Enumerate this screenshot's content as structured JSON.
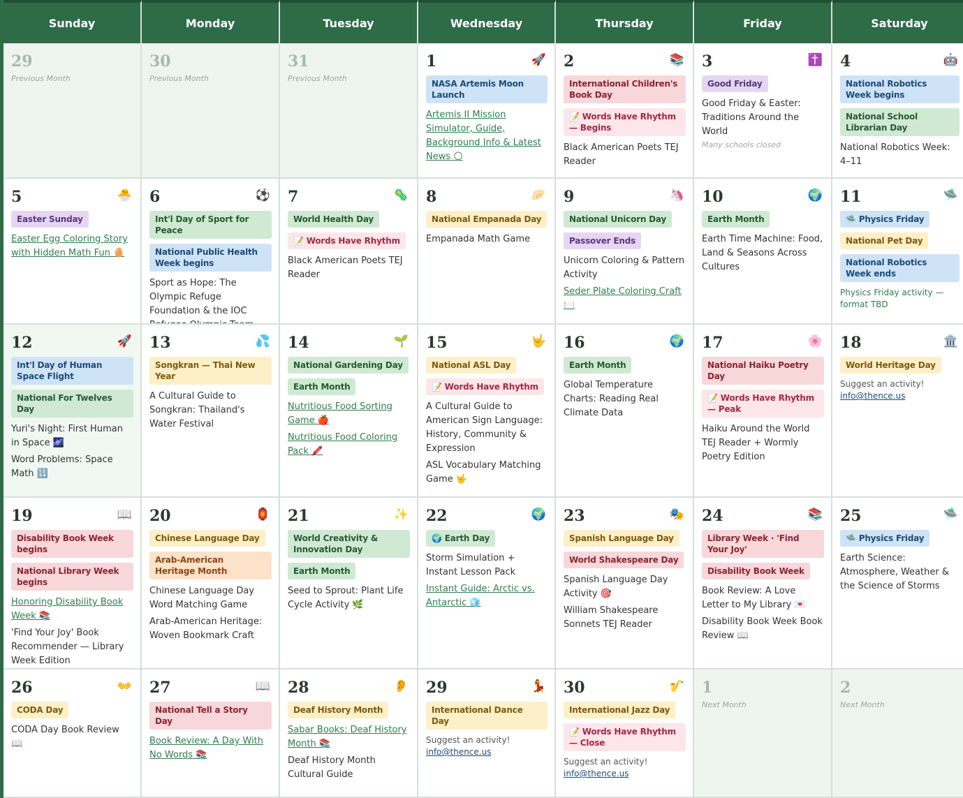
{
  "headers": [
    "Sunday",
    "Monday",
    "Tuesday",
    "Wednesday",
    "Thursday",
    "Friday",
    "Saturday"
  ],
  "prev_label": "Previous Month",
  "next_label": "Next Month",
  "suggest": "Suggest an activity!",
  "email": "info@thence.us",
  "days": {
    "d29p": "29",
    "d30p": "30",
    "d31p": "31",
    "d1": "1",
    "d2": "2",
    "d3": "3",
    "d4": "4",
    "d5": "5",
    "d6": "6",
    "d7": "7",
    "d8": "8",
    "d9": "9",
    "d10": "10",
    "d11": "11",
    "d12": "12",
    "d13": "13",
    "d14": "14",
    "d15": "15",
    "d16": "16",
    "d17": "17",
    "d18": "18",
    "d19": "19",
    "d20": "20",
    "d21": "21",
    "d22": "22",
    "d23": "23",
    "d24": "24",
    "d25": "25",
    "d26": "26",
    "d27": "27",
    "d28": "28",
    "d29": "29",
    "d30": "30",
    "n1": "1",
    "n2": "2"
  },
  "icons": {
    "d1": "🚀",
    "d2": "📚",
    "d3": "✝️",
    "d4": "🤖",
    "d5": "🐣",
    "d6": "⚽",
    "d7": "🦠",
    "d8": "🥟",
    "d9": "🦄",
    "d10": "🌍",
    "d11": "🛸",
    "d12": "🚀",
    "d13": "💦",
    "d14": "🌱",
    "d15": "🤟",
    "d16": "🌍",
    "d17": "🌸",
    "d18": "🏛️",
    "d19": "📖",
    "d20": "🏮",
    "d21": "✨",
    "d22": "🌍",
    "d23": "🎭",
    "d24": "📚",
    "d25": "🛸",
    "d26": "👐",
    "d27": "📖",
    "d28": "👂",
    "d29": "💃",
    "d30": "🎷"
  },
  "events": {
    "d1": {
      "tag1": "NASA Artemis Moon Launch",
      "link1": "Artemis II Mission Simulator, Guide, Background Info & Latest News 🌕"
    },
    "d2": {
      "tag1": "International Children's Book Day",
      "tag2": "📝 Words Have Rhythm — Begins",
      "txt1": "Black American Poets TEJ Reader"
    },
    "d3": {
      "tag1": "Good Friday",
      "txt1": "Good Friday & Easter: Traditions Around the World",
      "note": "Many schools closed"
    },
    "d4": {
      "tag1": "National Robotics Week begins",
      "tag2": "National School Librarian Day",
      "txt1": "National Robotics Week: 4–11"
    },
    "d5": {
      "tag1": "Easter Sunday",
      "link1": "Easter Egg Coloring Story with Hidden Math Fun 🥚"
    },
    "d6": {
      "tag1": "Int'l Day of Sport for Peace",
      "tag2": "National Public Health Week begins",
      "txt1": "Sport as Hope: The Olympic Refuge Foundation & the IOC Refugee Olympic Team"
    },
    "d7": {
      "tag1": "World Health Day",
      "tag2": "📝 Words Have Rhythm",
      "txt1": "Black American Poets TEJ Reader"
    },
    "d8": {
      "tag1": "National Empanada Day",
      "txt1": "Empanada Math Game"
    },
    "d9": {
      "tag1": "National Unicorn Day",
      "tag2": "Passover Ends",
      "txt1": "Unicorn Coloring & Pattern Activity",
      "link1": "Seder Plate Coloring Craft 🍽️"
    },
    "d10": {
      "tag1": "Earth Month",
      "txt1": "Earth Time Machine: Food, Land & Seasons Across Cultures"
    },
    "d11": {
      "tag1": "🛸 Physics Friday",
      "tag2": "National Pet Day",
      "tag3": "National Robotics Week ends",
      "txt1": "Physics Friday activity — format TBD"
    },
    "d12": {
      "tag1": "Int'l Day of Human Space Flight",
      "tag2": "National For Twelves Day",
      "txt1": "Yuri's Night: First Human in Space 🌌",
      "txt2": "Word Problems: Space Math 🔢"
    },
    "d13": {
      "tag1": "Songkran — Thai New Year",
      "txt1": "A Cultural Guide to Songkran: Thailand's Water Festival"
    },
    "d14": {
      "tag1": "National Gardening Day",
      "tag2": "Earth Month",
      "link1": "Nutritious Food Sorting Game 🍎",
      "link2": "Nutritious Food Coloring Pack 🖍️"
    },
    "d15": {
      "tag1": "National ASL Day",
      "tag2": "📝 Words Have Rhythm",
      "txt1": "A Cultural Guide to American Sign Language: History, Community & Expression",
      "txt2": "ASL Vocabulary Matching Game 🤟"
    },
    "d16": {
      "tag1": "Earth Month",
      "txt1": "Global Temperature Charts: Reading Real Climate Data"
    },
    "d17": {
      "tag1": "National Haiku Poetry Day",
      "tag2": "📝 Words Have Rhythm — Peak",
      "txt1": "Haiku Around the World TEJ Reader + Wormly Poetry Edition"
    },
    "d18": {
      "tag1": "World Heritage Day"
    },
    "d19": {
      "tag1": "Disability Book Week begins",
      "tag2": "National Library Week begins",
      "link1": "Honoring Disability Book Week 📚",
      "txt1": "'Find Your Joy' Book Recommender — Library Week Edition"
    },
    "d20": {
      "tag1": "Chinese Language Day",
      "tag2": "Arab-American Heritage Month",
      "txt1": "Chinese Language Day Word Matching Game",
      "txt2": "Arab-American Heritage: Woven Bookmark Craft"
    },
    "d21": {
      "tag1": "World Creativity & Innovation Day",
      "tag2": "Earth Month",
      "txt1": "Seed to Sprout: Plant Life Cycle Activity 🌿"
    },
    "d22": {
      "tag1": "🌍 Earth Day",
      "txt1": "Storm Simulation + Instant Lesson Pack",
      "link1": "Instant Guide: Arctic vs. Antarctic 🧊"
    },
    "d23": {
      "tag1": "Spanish Language Day",
      "tag2": "World Shakespeare Day",
      "txt1": "Spanish Language Day Activity 🎯",
      "txt2": "William Shakespeare Sonnets TEJ Reader"
    },
    "d24": {
      "tag1": "Library Week · 'Find Your Joy'",
      "tag2": "Disability Book Week",
      "txt1": "Book Review: A Love Letter to My Library 💌",
      "txt2": "Disability Book Week Book Review 📖"
    },
    "d25": {
      "tag1": "🛸 Physics Friday",
      "txt1": "Earth Science: Atmosphere, Weather & the Science of Storms"
    },
    "d26": {
      "tag1": "CODA Day",
      "txt1": "CODA Day Book Review 📖"
    },
    "d27": {
      "tag1": "National Tell a Story Day",
      "link1": "Book Review: A Day With No Words 📚"
    },
    "d28": {
      "tag1": "Deaf History Month",
      "link1": "Sabar Books: Deaf History Month 📚",
      "txt1": "Deaf History Month Cultural Guide"
    },
    "d29": {
      "tag1": "International Dance Day"
    },
    "d30": {
      "tag1": "International Jazz Day",
      "tag2": "📝 Words Have Rhythm — Close"
    }
  }
}
